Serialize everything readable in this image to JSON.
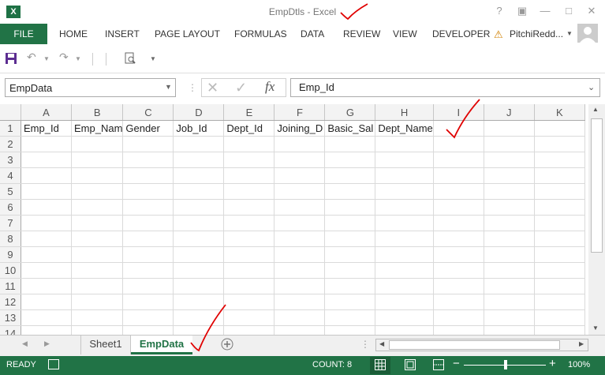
{
  "window": {
    "title": "EmpDtls - Excel",
    "help": "?"
  },
  "ribbon": {
    "tabs": [
      "FILE",
      "HOME",
      "INSERT",
      "PAGE LAYOUT",
      "FORMULAS",
      "DATA",
      "REVIEW",
      "VIEW",
      "DEVELOPER"
    ],
    "user": "PitchiRedd..."
  },
  "formula_bar": {
    "name_box": "EmpData",
    "fx_label": "fx",
    "formula": "Emp_Id"
  },
  "grid": {
    "columns": [
      "A",
      "B",
      "C",
      "D",
      "E",
      "F",
      "G",
      "H",
      "I",
      "J",
      "K"
    ],
    "rows": [
      "1",
      "2",
      "3",
      "4",
      "5",
      "6",
      "7",
      "8",
      "9",
      "10",
      "11",
      "12",
      "13",
      "14"
    ],
    "row1": [
      "Emp_Id",
      "Emp_Nam",
      "Gender",
      "Job_Id",
      "Dept_Id",
      "Joining_D",
      "Basic_Sal",
      "Dept_Name",
      "",
      "",
      ""
    ]
  },
  "sheets": {
    "tabs": [
      "Sheet1",
      "EmpData"
    ],
    "active": "EmpData"
  },
  "statusbar": {
    "ready": "READY",
    "count": "COUNT: 8",
    "zoom": "100%"
  },
  "colors": {
    "accent": "#217346",
    "annotation": "#e00000"
  }
}
